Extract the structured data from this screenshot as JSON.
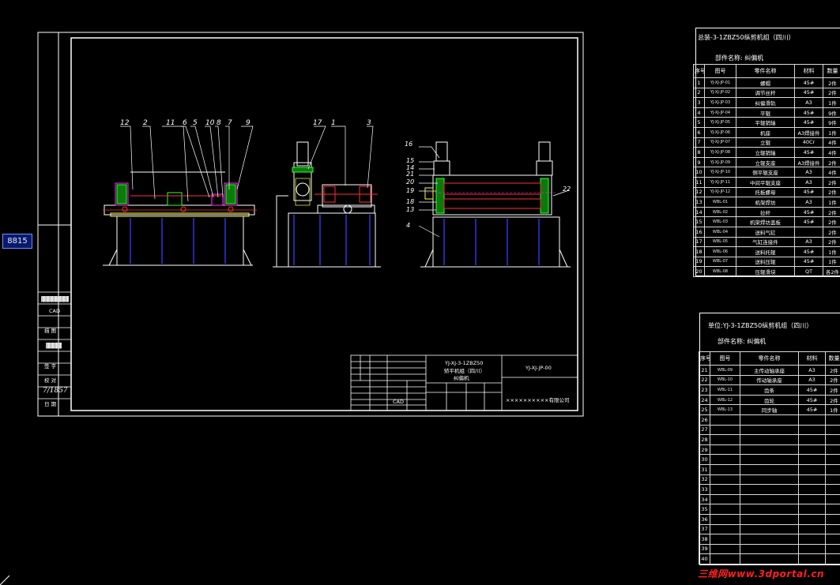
{
  "command_line": {
    "coordinate_readout": "8815"
  },
  "drawing": {
    "left_strip_labels": [
      "CAD",
      "描 图",
      "校 对",
      "签 字",
      "日 期"
    ],
    "left_strip_signature": "7/1857",
    "title_block": {
      "drawing_no": "YJ-XJ-3-1ZBZ50",
      "product_name": "矫平机组（四川）",
      "part_name": "纠偏机",
      "code": "YJ-XJ-JP-00",
      "cad_label": "CAD",
      "company": "××××××××××有限公司"
    },
    "callouts_front": [
      "12",
      "2",
      "11",
      "6",
      "5",
      "10",
      "8",
      "7",
      "9"
    ],
    "callouts_side": [
      "17",
      "1",
      "3"
    ],
    "callouts_rear": [
      "16",
      "15",
      "14",
      "21",
      "20",
      "19",
      "18",
      "13",
      "4",
      "22"
    ]
  },
  "bom1": {
    "title": "总装-3-1ZBZ50纵剪机组（四川）",
    "part_label": "部件名称: 纠偏机",
    "columns": [
      "序号",
      "图号",
      "零件名称",
      "材料",
      "数量"
    ],
    "rows": [
      [
        "1",
        "YJ-XJ-JP-01",
        "螺帽",
        "45#",
        "2件"
      ],
      [
        "2",
        "YJ-XJ-JP-02",
        "调节丝杆",
        "45#",
        "2件"
      ],
      [
        "3",
        "YJ-XJ-JP-03",
        "纠偏滑轨",
        "A3",
        "1件"
      ],
      [
        "4",
        "YJ-XJ-JP-04",
        "平辊",
        "45#",
        "9件"
      ],
      [
        "5",
        "YJ-XJ-JP-05",
        "平辊销轴",
        "45#",
        "9件"
      ],
      [
        "6",
        "YJ-XJ-JP-06",
        "机座",
        "A3焊接件",
        "1件"
      ],
      [
        "7",
        "YJ-XJ-JP-07",
        "立辊",
        "40Cr",
        "4件"
      ],
      [
        "8",
        "YJ-XJ-JP-08",
        "立辊销轴",
        "45#",
        "4件"
      ],
      [
        "9",
        "YJ-XJ-JP-09",
        "立辊支座",
        "A3焊接件",
        "2件"
      ],
      [
        "10",
        "YJ-XJ-JP-10",
        "侧平辊支座",
        "A3",
        "4件"
      ],
      [
        "11",
        "YJ-XJ-JP-11",
        "中间平辊支座",
        "A3",
        "2件"
      ],
      [
        "12",
        "YJ-XJ-JP-12",
        "托板螺母",
        "45#",
        "2件"
      ],
      [
        "13",
        "WBL-01",
        "机架焊坊",
        "A3",
        "1件"
      ],
      [
        "14",
        "WBL-02",
        "拉杆",
        "45#",
        "2件"
      ],
      [
        "15",
        "WBL-03",
        "机架焊坊盖板",
        "45#",
        "2件"
      ],
      [
        "16",
        "WBL-04",
        "送料气缸",
        "",
        "2件"
      ],
      [
        "17",
        "WBL-05",
        "气缸连接件",
        "A3",
        "2件"
      ],
      [
        "18",
        "WBL-06",
        "送料托辊",
        "45#",
        "1件"
      ],
      [
        "19",
        "WBL-07",
        "送料压辊",
        "45#",
        "1件"
      ],
      [
        "20",
        "WBL-08",
        "压辊滑块",
        "QT",
        "各2件"
      ]
    ]
  },
  "bom2": {
    "title": "单位:YJ-3-1ZBZ50纵剪机组（四川）",
    "part_label": "部件名称: 纠偏机",
    "columns": [
      "序号",
      "图号",
      "零件名称",
      "材料",
      "数量"
    ],
    "rows": [
      [
        "21",
        "WBL-09",
        "主传动轴承座",
        "A3",
        "2件"
      ],
      [
        "22",
        "WBL-10",
        "传动轴承座",
        "A3",
        "2件"
      ],
      [
        "23",
        "WBL-11",
        "齿条",
        "45#",
        "2件"
      ],
      [
        "24",
        "WBL-12",
        "齿轮",
        "45#",
        "2件"
      ],
      [
        "25",
        "WBL-13",
        "同步轴",
        "45#",
        "1件"
      ],
      [
        "26",
        "",
        "",
        "",
        ""
      ],
      [
        "27",
        "",
        "",
        "",
        ""
      ],
      [
        "28",
        "",
        "",
        "",
        ""
      ],
      [
        "29",
        "",
        "",
        "",
        ""
      ],
      [
        "30",
        "",
        "",
        "",
        ""
      ],
      [
        "31",
        "",
        "",
        "",
        ""
      ],
      [
        "32",
        "",
        "",
        "",
        ""
      ],
      [
        "33",
        "",
        "",
        "",
        ""
      ],
      [
        "34",
        "",
        "",
        "",
        ""
      ],
      [
        "35",
        "",
        "",
        "",
        ""
      ],
      [
        "36",
        "",
        "",
        "",
        ""
      ],
      [
        "37",
        "",
        "",
        "",
        ""
      ],
      [
        "38",
        "",
        "",
        "",
        ""
      ],
      [
        "39",
        "",
        "",
        "",
        ""
      ],
      [
        "40",
        "",
        "",
        "",
        ""
      ]
    ]
  },
  "watermark": "三维网www.3dportal.cn",
  "colors": {
    "background": "#000000",
    "linework": "#ffffff",
    "frame_blue": "#3030ff",
    "dim_green": "#30ff30",
    "accent_red": "#ff3030",
    "callout_yellow": "#ffff40",
    "hidden_magenta": "#ff30ff"
  }
}
